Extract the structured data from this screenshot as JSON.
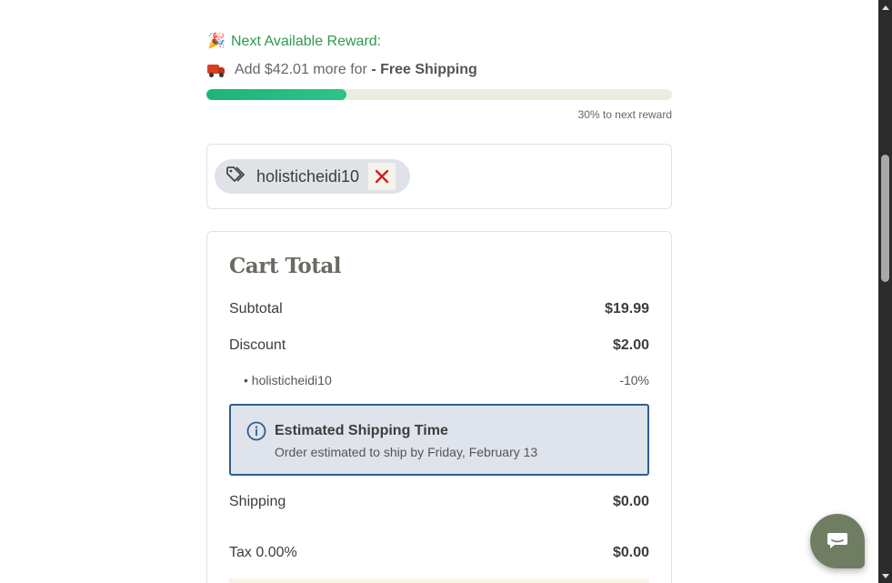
{
  "reward": {
    "title_emoji": "🎉",
    "title": "Next Available Reward:",
    "add_text": "Add $42.01 more for",
    "reward_name": "- Free Shipping",
    "progress_fraction": 0.3,
    "progress_label": "30% to next reward",
    "accent_color": "#2e9a4e"
  },
  "coupon": {
    "code": "holisticheidi10",
    "icon": "tag-icon",
    "remove_icon": "close-icon"
  },
  "cart": {
    "title": "Cart Total",
    "subtotal_label": "Subtotal",
    "subtotal_value": "$19.99",
    "discount_label": "Discount",
    "discount_value": "$2.00",
    "discount_code": "holisticheidi10",
    "discount_percent": "-10%",
    "shipping_note_title": "Estimated Shipping Time",
    "shipping_note_text": "Order estimated to ship by Friday, February 13",
    "shipping_label": "Shipping",
    "shipping_value": "$0.00",
    "tax_label": "Tax 0.00%",
    "tax_value": "$0.00"
  },
  "chat": {
    "icon": "chat-bubble-icon",
    "color": "#6f7e63"
  }
}
